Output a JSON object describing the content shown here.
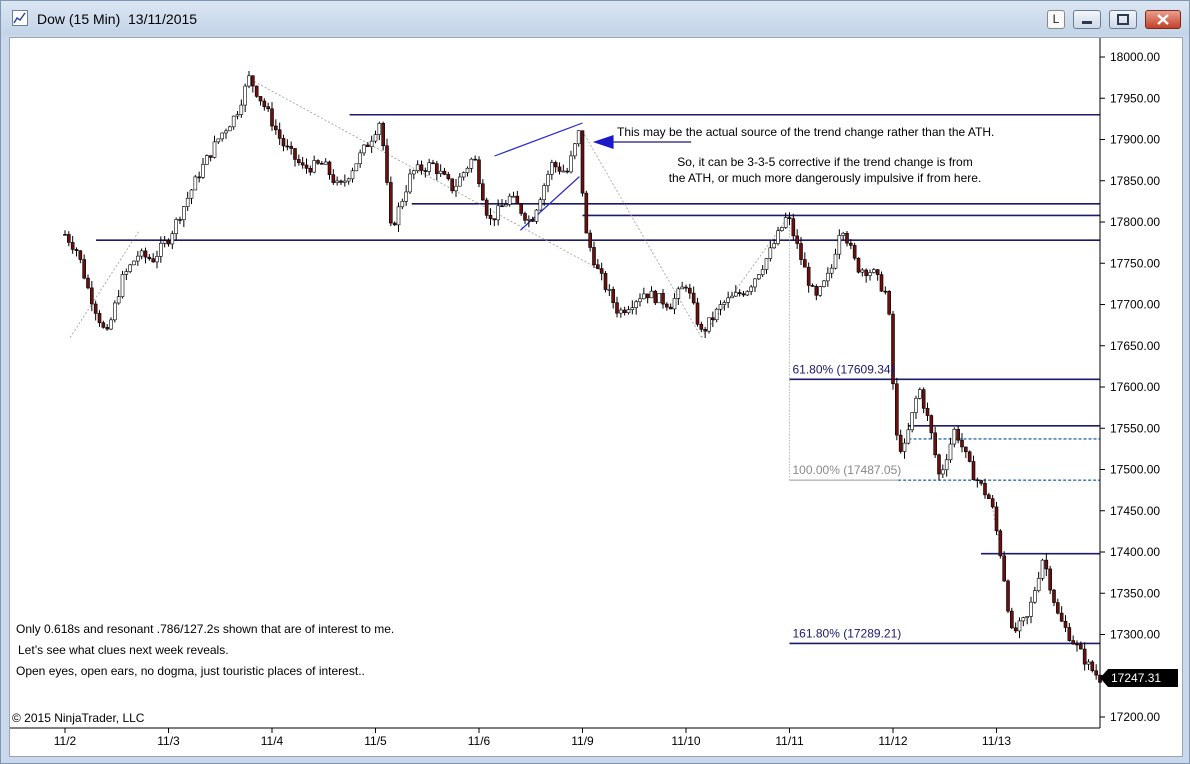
{
  "window": {
    "title": "Dow (15 Min)  13/11/2015",
    "link_button": "L"
  },
  "chart_data": {
    "type": "candlestick",
    "instrument": "Dow",
    "interval": "15 Min",
    "date": "13/11/2015",
    "y_axis": {
      "side": "right",
      "range": [
        17190,
        18030
      ],
      "ticks": [
        18000,
        17950,
        17900,
        17850,
        17800,
        17750,
        17700,
        17650,
        17600,
        17550,
        17500,
        17450,
        17400,
        17350,
        17300,
        17250,
        17200
      ],
      "tick_labels": [
        "18000.00",
        "17950.00",
        "17900.00",
        "17850.00",
        "17800.00",
        "17750.00",
        "17700.00",
        "17650.00",
        "17600.00",
        "17550.00",
        "17500.00",
        "17450.00",
        "17400.00",
        "17350.00",
        "17300.00",
        "17250.00",
        "17200.00"
      ]
    },
    "x_axis": {
      "labels": [
        "11/2",
        "11/3",
        "11/4",
        "11/5",
        "11/6",
        "11/9",
        "11/10",
        "11/11",
        "11/12",
        "11/13"
      ],
      "session_index": [
        0,
        1,
        2,
        3,
        4,
        5,
        6,
        7,
        8,
        9
      ]
    },
    "grid": false,
    "last_price": "17247.31",
    "price_path": [
      {
        "t": 0.0,
        "p": 17785
      },
      {
        "t": 0.12,
        "p": 17765
      },
      {
        "t": 0.22,
        "p": 17720
      },
      {
        "t": 0.4,
        "p": 17660
      },
      {
        "t": 0.55,
        "p": 17730
      },
      {
        "t": 0.7,
        "p": 17760
      },
      {
        "t": 0.85,
        "p": 17755
      },
      {
        "t": 1.0,
        "p": 17780
      },
      {
        "t": 1.15,
        "p": 17820
      },
      {
        "t": 1.3,
        "p": 17860
      },
      {
        "t": 1.5,
        "p": 17905
      },
      {
        "t": 1.65,
        "p": 17930
      },
      {
        "t": 1.78,
        "p": 17975
      },
      {
        "t": 1.95,
        "p": 17935
      },
      {
        "t": 2.1,
        "p": 17895
      },
      {
        "t": 2.3,
        "p": 17865
      },
      {
        "t": 2.5,
        "p": 17870
      },
      {
        "t": 2.65,
        "p": 17840
      },
      {
        "t": 2.8,
        "p": 17870
      },
      {
        "t": 2.95,
        "p": 17900
      },
      {
        "t": 3.05,
        "p": 17925
      },
      {
        "t": 3.15,
        "p": 17790
      },
      {
        "t": 3.35,
        "p": 17860
      },
      {
        "t": 3.55,
        "p": 17870
      },
      {
        "t": 3.75,
        "p": 17840
      },
      {
        "t": 3.95,
        "p": 17880
      },
      {
        "t": 4.1,
        "p": 17800
      },
      {
        "t": 4.3,
        "p": 17830
      },
      {
        "t": 4.5,
        "p": 17800
      },
      {
        "t": 4.7,
        "p": 17870
      },
      {
        "t": 4.85,
        "p": 17860
      },
      {
        "t": 4.97,
        "p": 17910
      },
      {
        "t": 5.02,
        "p": 17790
      },
      {
        "t": 5.15,
        "p": 17740
      },
      {
        "t": 5.35,
        "p": 17690
      },
      {
        "t": 5.6,
        "p": 17715
      },
      {
        "t": 5.85,
        "p": 17700
      },
      {
        "t": 6.0,
        "p": 17725
      },
      {
        "t": 6.15,
        "p": 17665
      },
      {
        "t": 6.35,
        "p": 17700
      },
      {
        "t": 6.6,
        "p": 17720
      },
      {
        "t": 6.8,
        "p": 17760
      },
      {
        "t": 6.98,
        "p": 17808
      },
      {
        "t": 7.1,
        "p": 17760
      },
      {
        "t": 7.25,
        "p": 17705
      },
      {
        "t": 7.4,
        "p": 17740
      },
      {
        "t": 7.5,
        "p": 17800
      },
      {
        "t": 7.65,
        "p": 17745
      },
      {
        "t": 7.8,
        "p": 17740
      },
      {
        "t": 7.95,
        "p": 17710
      },
      {
        "t": 8.03,
        "p": 17540
      },
      {
        "t": 8.1,
        "p": 17520
      },
      {
        "t": 8.25,
        "p": 17600
      },
      {
        "t": 8.35,
        "p": 17555
      },
      {
        "t": 8.45,
        "p": 17490
      },
      {
        "t": 8.6,
        "p": 17550
      },
      {
        "t": 8.75,
        "p": 17500
      },
      {
        "t": 8.95,
        "p": 17460
      },
      {
        "t": 9.05,
        "p": 17390
      },
      {
        "t": 9.15,
        "p": 17300
      },
      {
        "t": 9.3,
        "p": 17320
      },
      {
        "t": 9.45,
        "p": 17395
      },
      {
        "t": 9.6,
        "p": 17320
      },
      {
        "t": 9.75,
        "p": 17290
      },
      {
        "t": 9.9,
        "p": 17260
      },
      {
        "t": 10.0,
        "p": 17247
      }
    ],
    "levels": [
      {
        "price": 17930,
        "from": 2.75,
        "to": 10.1,
        "color": "#1a1a6e"
      },
      {
        "price": 17822,
        "from": 3.35,
        "to": 10.1,
        "color": "#1a1a6e"
      },
      {
        "price": 17808,
        "from": 5.0,
        "to": 10.1,
        "color": "#1a1a6e"
      },
      {
        "price": 17778,
        "from": 0.3,
        "to": 10.1,
        "color": "#1a1a6e"
      },
      {
        "price": 17609.34,
        "from": 7.0,
        "to": 10.1,
        "color": "#1a1a6e"
      },
      {
        "price": 17553,
        "from": 8.15,
        "to": 10.1,
        "color": "#1a1a6e"
      },
      {
        "price": 17398,
        "from": 8.85,
        "to": 10.1,
        "color": "#1a1a6e"
      },
      {
        "price": 17289.21,
        "from": 7.0,
        "to": 10.1,
        "color": "#1a1a6e"
      }
    ],
    "dashed_levels": [
      {
        "price": 17537,
        "from": 8.15,
        "to": 10.1,
        "color": "#2a6fb0"
      },
      {
        "price": 17487.05,
        "from": 8.05,
        "to": 10.1,
        "color": "#2a6fb0"
      }
    ],
    "fib_labels": [
      {
        "text": "61.80% (17609.34)",
        "price": 17609.34,
        "color": "#1a1a6e"
      },
      {
        "text": "100.00% (17487.05)",
        "price": 17487.05,
        "color": "#888888"
      },
      {
        "text": "161.80% (17289.21)",
        "price": 17289.21,
        "color": "#1a1a6e"
      }
    ],
    "annotations": [
      "This may be the actual source of the trend change rather than the ATH.",
      "So, it can be 3-3-5 corrective if the trend change is from",
      "the ATH, or much more dangerously impulsive if from here.",
      "Only 0.618s and resonant .786/127.2s shown that are of interest to me.",
      "Let’s see what clues next week reveals.",
      "Open eyes, open ears, no dogma, just touristic places of interest.."
    ],
    "copyright": "© 2015 NinjaTrader, LLC",
    "colors": {
      "up": "#ffffff",
      "down": "#6b0f0f",
      "wick": "#000000",
      "line": "#1a1a6e",
      "arrow": "#1a1acc"
    }
  }
}
